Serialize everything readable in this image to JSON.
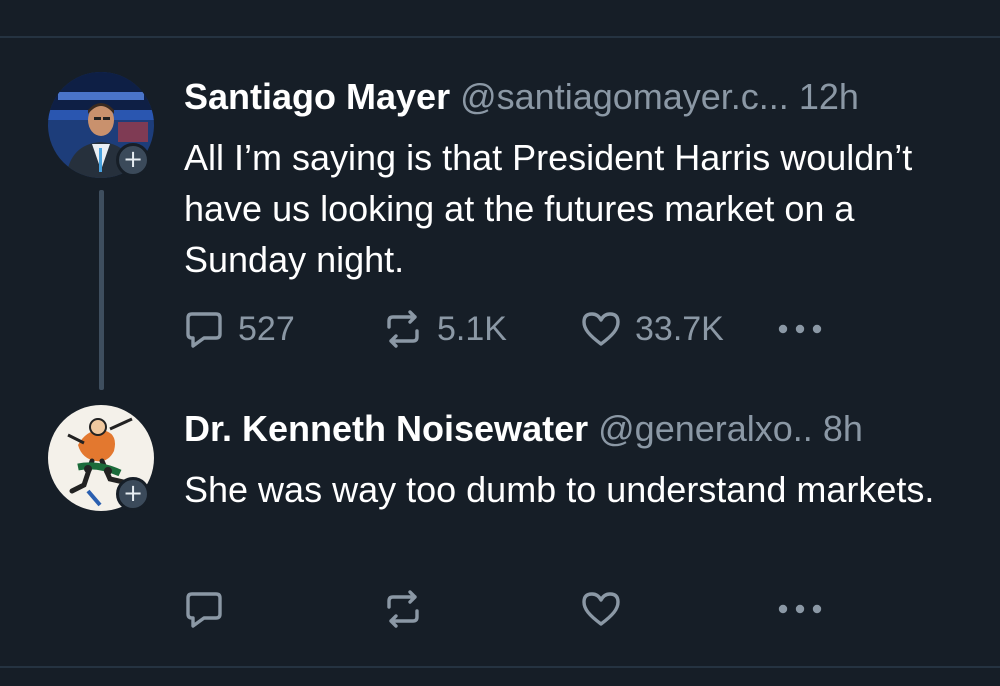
{
  "tweets": [
    {
      "author_name": "Santiago Mayer",
      "handle": "@santiagomayer.c...",
      "time": "12h",
      "text": "All I’m saying is that President Harris wouldn’t have us looking at the futures market on a Sunday night.",
      "follow_badge": "+",
      "replies": "527",
      "reposts": "5.1K",
      "likes": "33.7K"
    },
    {
      "author_name": "Dr. Kenneth Noisewater",
      "handle": "@generalxo..",
      "time": "8h",
      "text": "She was way too dumb to understand markets.",
      "follow_badge": "+"
    }
  ],
  "icons": {
    "reply": "speech-bubble-icon",
    "repost": "repost-arrows-icon",
    "like": "heart-icon",
    "more": "ellipsis-icon",
    "follow": "plus-icon"
  },
  "colors": {
    "background": "#161e27",
    "secondary_text": "#8b98a5",
    "thread_line": "#3e4e5e"
  }
}
